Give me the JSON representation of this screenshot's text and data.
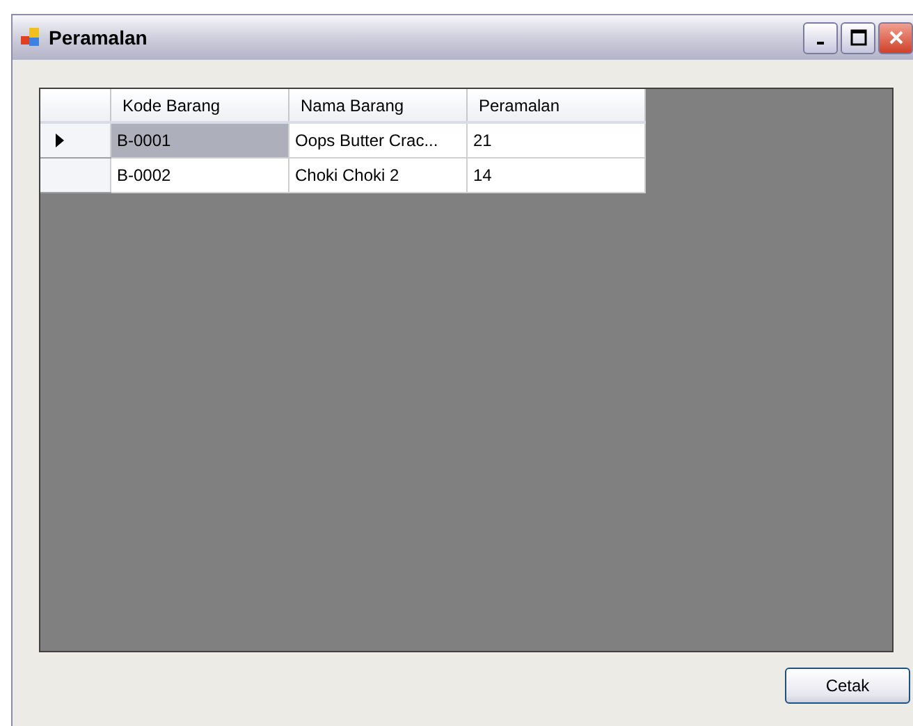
{
  "window": {
    "title": "Peramalan"
  },
  "table": {
    "columns": [
      "Kode Barang",
      "Nama Barang",
      "Peramalan"
    ],
    "rows": [
      {
        "cells": [
          "B-0001",
          "Oops Butter Crac...",
          "21"
        ],
        "selected": true
      },
      {
        "cells": [
          "B-0002",
          "Choki Choki 2",
          "14"
        ],
        "selected": false
      }
    ]
  },
  "buttons": [
    "Cetak"
  ]
}
